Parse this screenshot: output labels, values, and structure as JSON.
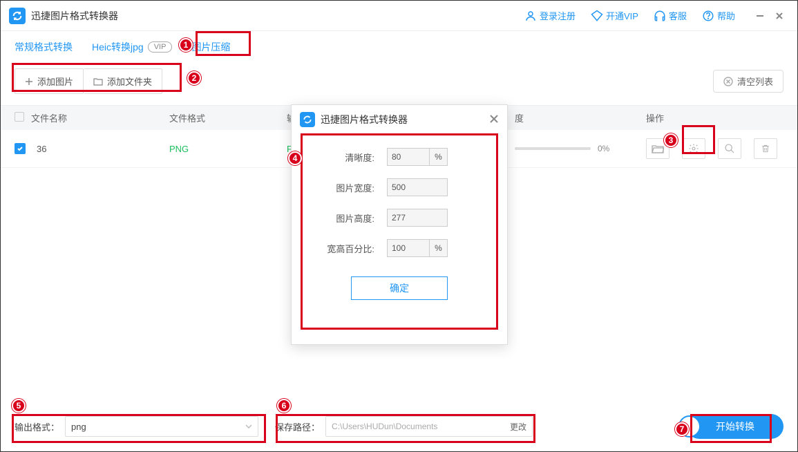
{
  "app": {
    "title": "迅捷图片格式转换器"
  },
  "titlebar": {
    "login": "登录注册",
    "vip": "开通VIP",
    "service": "客服",
    "help": "帮助"
  },
  "tabs": {
    "normal": "常规格式转换",
    "heic": "Heic转换jpg",
    "vip_badge": "VIP",
    "compress": "图片压缩"
  },
  "toolbar": {
    "add_image": "添加图片",
    "add_folder": "添加文件夹",
    "clear_list": "清空列表"
  },
  "table": {
    "headers": {
      "name": "文件名称",
      "format": "文件格式",
      "out_prefix": "输",
      "progress_prefix": "度",
      "ops": "操作"
    },
    "row": {
      "name": "36",
      "format": "PNG",
      "out_letter": "P",
      "progress_pct": "0%"
    }
  },
  "dialog": {
    "title": "迅捷图片格式转换器",
    "clarity_label": "清晰度:",
    "clarity_value": "80",
    "width_label": "图片宽度:",
    "width_value": "500",
    "height_label": "图片高度:",
    "height_value": "277",
    "ratio_label": "宽高百分比:",
    "ratio_value": "100",
    "percent": "%",
    "confirm": "确定"
  },
  "bottom": {
    "out_format_label": "输出格式：",
    "out_format_value": "png",
    "save_path_label": "保存路径：",
    "save_path_value": "C:\\Users\\HUDun\\Documents",
    "change": "更改",
    "start": "开始转换"
  },
  "callouts": {
    "c1": "1",
    "c2": "2",
    "c3": "3",
    "c4": "4",
    "c5": "5",
    "c6": "6",
    "c7": "7"
  }
}
